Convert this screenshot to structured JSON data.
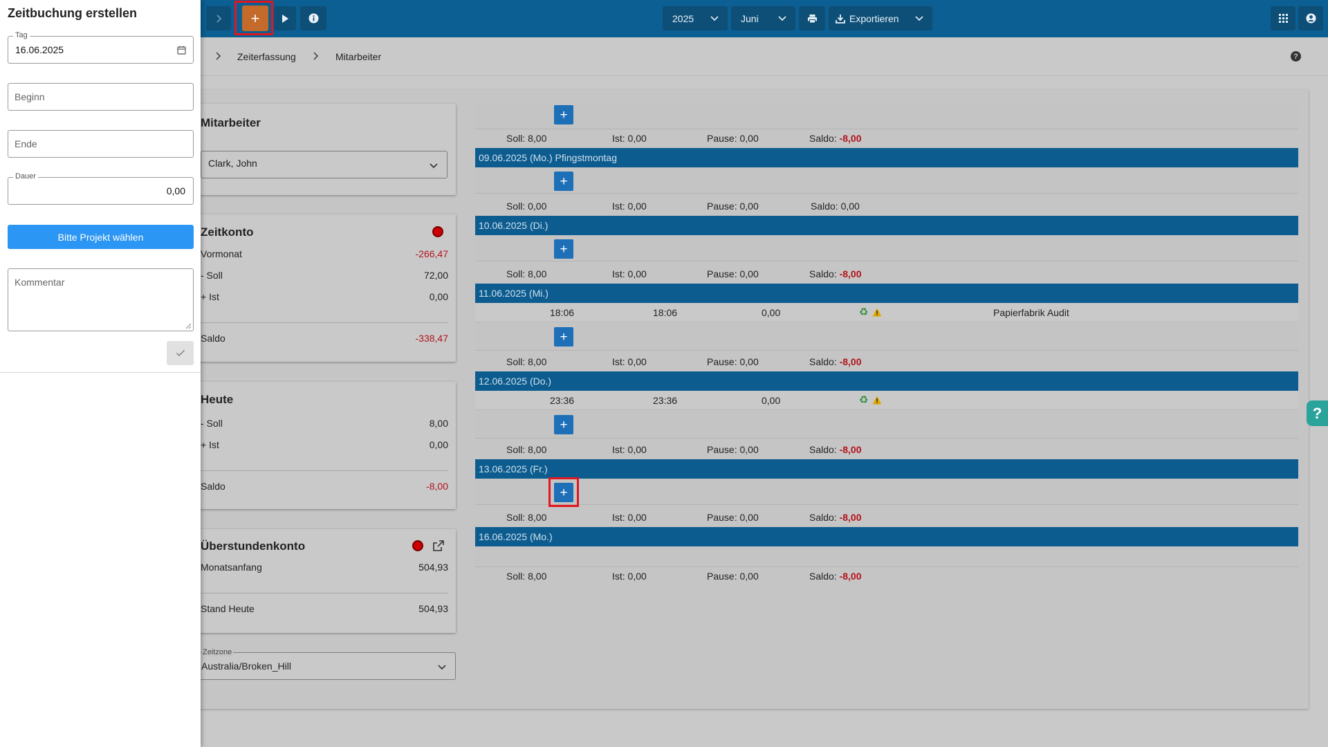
{
  "topbar": {
    "year": "2025",
    "month": "Juni",
    "export_label": "Exportieren"
  },
  "breadcrumb": {
    "items": [
      "Zeiterfassung",
      "Mitarbeiter"
    ]
  },
  "employee_card": {
    "title": "Mitarbeiter",
    "selected": "Clark, John"
  },
  "zeitkonto": {
    "title": "Zeitkonto",
    "rows": [
      {
        "label": "Vormonat",
        "value": "-266,47"
      },
      {
        "label": "- Soll",
        "value": "72,00"
      },
      {
        "label": "+ Ist",
        "value": "0,00"
      }
    ],
    "saldo_label": "Saldo",
    "saldo_value": "-338,47"
  },
  "heute": {
    "title": "Heute",
    "rows": [
      {
        "label": "- Soll",
        "value": "8,00"
      },
      {
        "label": "+ Ist",
        "value": "0,00"
      }
    ],
    "saldo_label": "Saldo",
    "saldo_value": "-8,00"
  },
  "ueberstunden": {
    "title": "Überstundenkonto",
    "rows": [
      {
        "label": "Monatsanfang",
        "value": "504,93"
      }
    ],
    "stand_label": "Stand Heute",
    "stand_value": "504,93"
  },
  "timezone": {
    "legend": "Zeitzone",
    "value": "Australia/Broken_Hill"
  },
  "days": [
    {
      "summary": {
        "soll": "Soll: 8,00",
        "ist": "Ist: 0,00",
        "pause": "Pause: 0,00",
        "saldo_label": "Saldo:",
        "saldo_value": "-8,00"
      }
    },
    {
      "header": "09.06.2025 (Mo.) Pfingstmontag",
      "summary": {
        "soll": "Soll: 0,00",
        "ist": "Ist: 0,00",
        "pause": "Pause: 0,00",
        "saldo_label": "Saldo:",
        "saldo_value": "0,00"
      }
    },
    {
      "header": "10.06.2025 (Di.)",
      "summary": {
        "soll": "Soll: 8,00",
        "ist": "Ist: 0,00",
        "pause": "Pause: 0,00",
        "saldo_label": "Saldo:",
        "saldo_value": "-8,00"
      }
    },
    {
      "header": "11.06.2025 (Mi.)",
      "entry": {
        "start": "18:06",
        "end": "18:06",
        "duration": "0,00",
        "project": "Papierfabrik Audit"
      },
      "summary": {
        "soll": "Soll: 8,00",
        "ist": "Ist: 0,00",
        "pause": "Pause: 0,00",
        "saldo_label": "Saldo:",
        "saldo_value": "-8,00"
      }
    },
    {
      "header": "12.06.2025 (Do.)",
      "entry": {
        "start": "23:36",
        "end": "23:36",
        "duration": "0,00"
      },
      "summary": {
        "soll": "Soll: 8,00",
        "ist": "Ist: 0,00",
        "pause": "Pause: 0,00",
        "saldo_label": "Saldo:",
        "saldo_value": "-8,00"
      }
    },
    {
      "header": "13.06.2025 (Fr.)",
      "summary": {
        "soll": "Soll: 8,00",
        "ist": "Ist: 0,00",
        "pause": "Pause: 0,00",
        "saldo_label": "Saldo:",
        "saldo_value": "-8,00"
      }
    },
    {
      "header": "16.06.2025 (Mo.)",
      "summary": {
        "soll": "Soll: 8,00",
        "ist": "Ist: 0,00",
        "pause": "Pause: 0,00",
        "saldo_label": "Saldo:",
        "saldo_value": "-8,00"
      }
    }
  ],
  "panel": {
    "title": "Zeitbuchung erstellen",
    "tag_legend": "Tag",
    "tag_value": "16.06.2025",
    "beginn_label": "Beginn",
    "ende_label": "Ende",
    "dauer_legend": "Dauer",
    "dauer_value": "0,00",
    "project_button": "Bitte Projekt wählen",
    "kommentar_label": "Kommentar"
  },
  "colors": {
    "topbar": "#0b5f92",
    "day_header": "#0d5c8f",
    "add_button": "#1d6fb8",
    "primary_button": "#2b96f3",
    "negative": "#b3121b",
    "highlight": "#e3161f"
  }
}
